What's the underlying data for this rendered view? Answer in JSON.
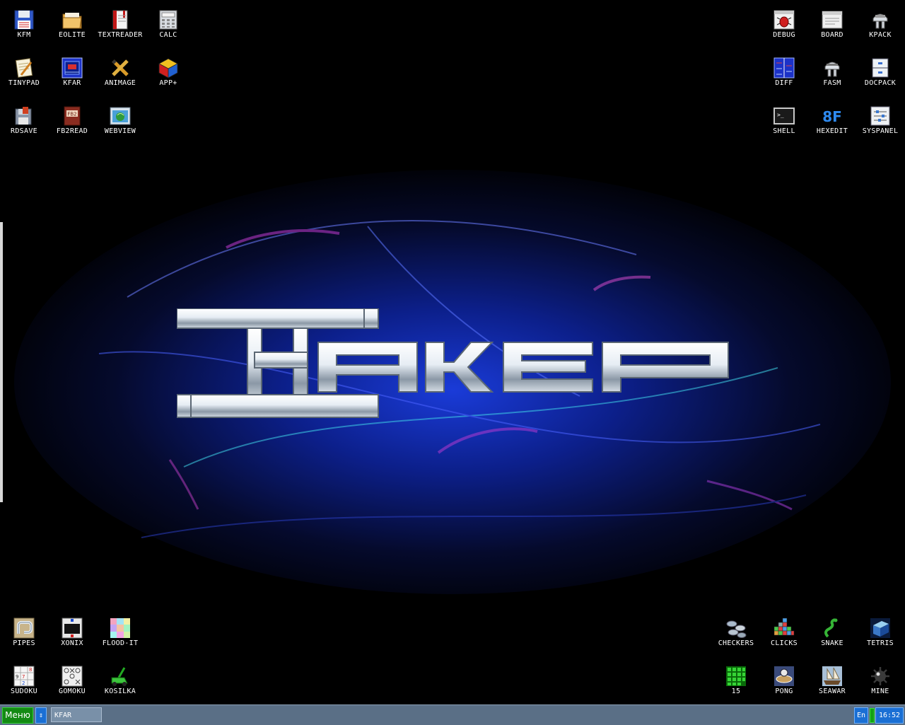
{
  "desktop": {
    "top_left": [
      {
        "name": "kfm",
        "label": "KFM",
        "icon": "floppy-icon"
      },
      {
        "name": "eolite",
        "label": "EOLITE",
        "icon": "folder-icon"
      },
      {
        "name": "textreader",
        "label": "TEXTREADER",
        "icon": "book-icon"
      },
      {
        "name": "calc",
        "label": "CALC",
        "icon": "calculator-icon"
      },
      {
        "name": "tinypad",
        "label": "TINYPAD",
        "icon": "notepad-icon"
      },
      {
        "name": "kfar",
        "label": "KFAR",
        "icon": "kfar-icon"
      },
      {
        "name": "animage",
        "label": "ANIMAGE",
        "icon": "pencil-icon"
      },
      {
        "name": "app-plus",
        "label": "APP+",
        "icon": "cube-icon"
      },
      {
        "name": "rdsave",
        "label": "RDSAVE",
        "icon": "disk-save-icon"
      },
      {
        "name": "fb2read",
        "label": "FB2READ",
        "icon": "fb2-book-icon"
      },
      {
        "name": "webview",
        "label": "WEBVIEW",
        "icon": "globe-window-icon"
      }
    ],
    "top_right": [
      {
        "name": "debug",
        "label": "DEBUG",
        "icon": "bug-icon"
      },
      {
        "name": "board",
        "label": "BOARD",
        "icon": "board-icon"
      },
      {
        "name": "kpack",
        "label": "KPACK",
        "icon": "pack-icon"
      },
      {
        "name": "diff",
        "label": "DIFF",
        "icon": "diff-icon"
      },
      {
        "name": "fasm",
        "label": "FASM",
        "icon": "fasm-icon"
      },
      {
        "name": "docpack",
        "label": "DOCPACK",
        "icon": "cabinet-icon"
      },
      {
        "name": "shell",
        "label": "SHELL",
        "icon": "terminal-icon"
      },
      {
        "name": "hexedit",
        "label": "HEXEDIT",
        "icon": "hex-icon"
      },
      {
        "name": "syspanel",
        "label": "SYSPANEL",
        "icon": "sliders-icon"
      }
    ],
    "bottom_left": [
      {
        "name": "pipes",
        "label": "PIPES",
        "icon": "pipes-icon"
      },
      {
        "name": "xonix",
        "label": "XONIX",
        "icon": "xonix-icon"
      },
      {
        "name": "flood-it",
        "label": "FLOOD-IT",
        "icon": "flood-grid-icon"
      },
      {
        "name": "sudoku",
        "label": "SUDOKU",
        "icon": "sudoku-icon"
      },
      {
        "name": "gomoku",
        "label": "GOMOKU",
        "icon": "gomoku-icon"
      },
      {
        "name": "kosilka",
        "label": "KOSILKA",
        "icon": "lawnmower-icon"
      }
    ],
    "bottom_right": [
      {
        "name": "checkers",
        "label": "CHECKERS",
        "icon": "checkers-icon"
      },
      {
        "name": "clicks",
        "label": "CLICKS",
        "icon": "blocks-icon"
      },
      {
        "name": "snake",
        "label": "SNAKE",
        "icon": "snake-icon"
      },
      {
        "name": "tetris",
        "label": "TETRIS",
        "icon": "tetris-icon"
      },
      {
        "name": "fifteen",
        "label": "15",
        "icon": "fifteen-grid-icon"
      },
      {
        "name": "pong",
        "label": "PONG",
        "icon": "pong-icon"
      },
      {
        "name": "seawar",
        "label": "SEAWAR",
        "icon": "ship-icon"
      },
      {
        "name": "mine",
        "label": "MINE",
        "icon": "mine-icon"
      }
    ]
  },
  "wallpaper": {
    "logo_text": "ХАКЕР"
  },
  "taskbar": {
    "menu_label": "Меню",
    "switch_label": "⇕",
    "tasks": [
      {
        "label": "KFAR"
      }
    ],
    "language": "En",
    "clock": "16:52"
  },
  "colors": {
    "taskbar": "#5a6f86",
    "menu_button": "#138a13",
    "tray_blue": "#1a6fd4",
    "desktop_bg": "#000000"
  }
}
